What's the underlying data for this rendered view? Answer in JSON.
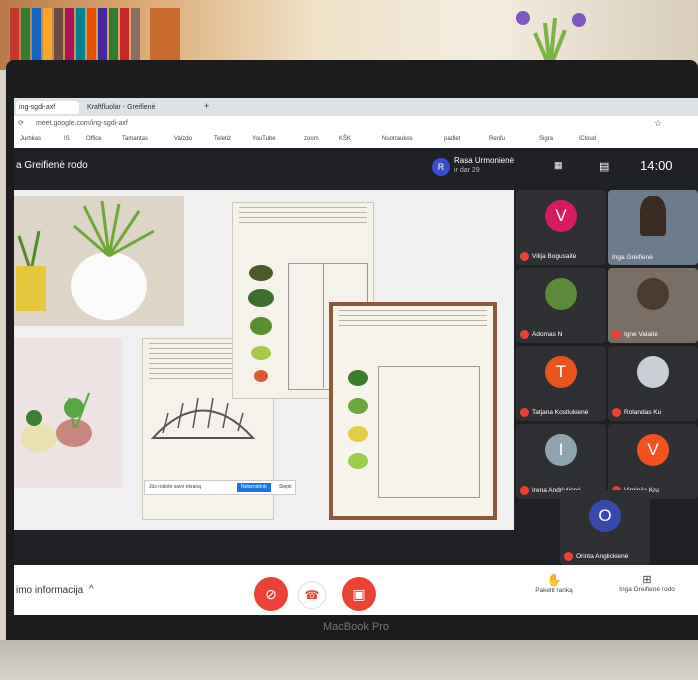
{
  "browser": {
    "tabs": [
      "ing-sgdi-axf",
      "Kraftfluolar - Greifienė"
    ],
    "url": "meet.google.com/ing-sgdi-axf",
    "bookmarks": [
      "Jurbkas",
      "IS",
      "Office",
      "Tamantas",
      "Vaizdo",
      "Teletiz",
      "YouTube",
      "zoom",
      "KŠK",
      "Nuotraukos",
      "padlet",
      "Renfu",
      "Sigra",
      "iCloud"
    ]
  },
  "meet": {
    "meeting_title": "a Greifienė rodo",
    "presenter_initial": "R",
    "presenter_name": "Rasa Urmonienė",
    "presenter_sub": "ir dar 29",
    "time": "14:00",
    "participants": [
      {
        "name": "Vilija Bogusaitė",
        "initial": "V",
        "color": "#d81b60"
      },
      {
        "name": "Inga Greifienė",
        "initial": "",
        "color": "#5f6368"
      },
      {
        "name": "Adomas N",
        "initial": "",
        "color": "#5d8a3a"
      },
      {
        "name": "Ignė Valaitė",
        "initial": "",
        "color": "#6b5a4a"
      },
      {
        "name": "Tatjana Kostiukienė",
        "initial": "T",
        "color": "#e8541e"
      },
      {
        "name": "Rolandas Ku",
        "initial": "",
        "color": "#8a9aa8"
      },
      {
        "name": "Irena Andriulienė",
        "initial": "I",
        "color": "#90a4ae"
      },
      {
        "name": "Virginija Kru",
        "initial": "V",
        "color": "#f4511e"
      },
      {
        "name": "Orinta Anglickienė",
        "initial": "O",
        "color": "#3949ab"
      }
    ],
    "bottom": {
      "info_label": "imo informacija",
      "raise_hand": "Pakelti ranką",
      "presenting": "Inga Greifienė rodo"
    },
    "share_banner": {
      "text": "Jūs rodote savo ekraną",
      "stop": "Nebendrinti",
      "hide": "Slėpti"
    }
  },
  "laptop": {
    "brand": "MacBook Pro"
  }
}
